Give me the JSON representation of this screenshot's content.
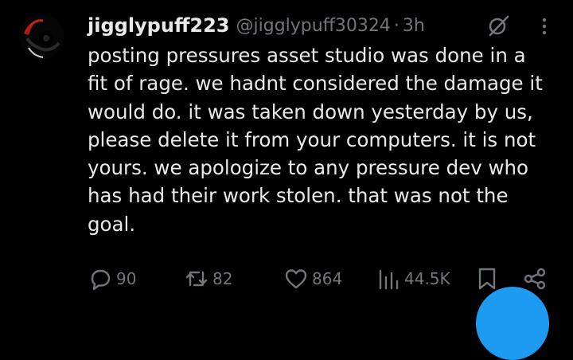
{
  "tweet": {
    "display_name": "jigglypuff223",
    "handle": "@jigglypuff30324",
    "separator": "·",
    "timestamp": "3h",
    "text": "posting pressures asset studio was done in a\nfit of rage. we hadnt considered the damage it\nwould do. it was taken down yesterday by us,\nplease delete it from your computers. it is not\nyours. we apologize to any pressure dev who\nhas had their work stolen. that was not the\ngoal."
  },
  "actions": {
    "replies": "90",
    "reposts": "82",
    "likes": "864",
    "views": "44.5K"
  },
  "icons": {
    "avatar": "avatar-image",
    "grok": "grok-icon",
    "more": "more-icon",
    "reply": "reply-icon",
    "repost": "repost-icon",
    "like": "heart-icon",
    "views": "views-icon",
    "bookmark": "bookmark-icon",
    "share": "share-icon",
    "compose": "compose-fab"
  },
  "colors": {
    "background": "#000000",
    "text": "#e7e9ea",
    "muted": "#71767b",
    "accent": "#1d9bf0"
  }
}
